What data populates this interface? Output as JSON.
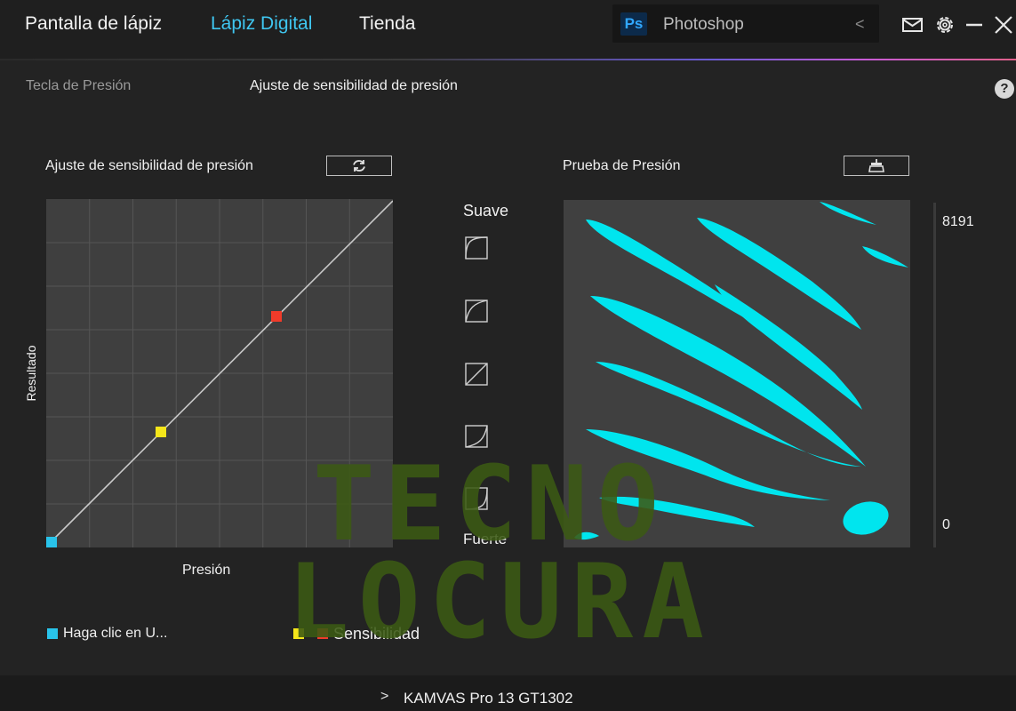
{
  "nav": {
    "tabs": [
      "Pantalla de lápiz",
      "Lápiz Digital",
      "Tienda"
    ],
    "active_index": 1
  },
  "app_selector": {
    "icon_text": "Ps",
    "name": "Photoshop",
    "chevron": "<"
  },
  "window_icons": [
    "mail-icon",
    "settings-icon",
    "minimize-icon",
    "close-icon"
  ],
  "sub_tabs": [
    "Tecla de Presión",
    "Ajuste de sensibilidad de presión"
  ],
  "help_label": "?",
  "curve_section": {
    "title": "Ajuste de sensibilidad de presión",
    "reset_icon": "refresh-icon",
    "y_label": "Resultado",
    "x_label": "Presión"
  },
  "presets": {
    "soft_label": "Suave",
    "hard_label": "Fuerte",
    "count": 5
  },
  "test_section": {
    "title": "Prueba de Presión",
    "clear_icon": "broom-icon",
    "max_value": "8191",
    "min_value": "0"
  },
  "legend": {
    "item1": "Haga clic en U...",
    "item2": "Sensibilidad"
  },
  "watermark": {
    "line1": "TECNO",
    "line2": "LOCURA"
  },
  "footer": {
    "chevron": ">",
    "device": "KAMVAS Pro 13 GT1302"
  },
  "colors": {
    "accent": "#3fc6f0",
    "stroke_cyan": "#00e5ee",
    "point_start": "#29c3ea",
    "point_yellow": "#f5e61a",
    "point_red": "#f03b2a"
  }
}
